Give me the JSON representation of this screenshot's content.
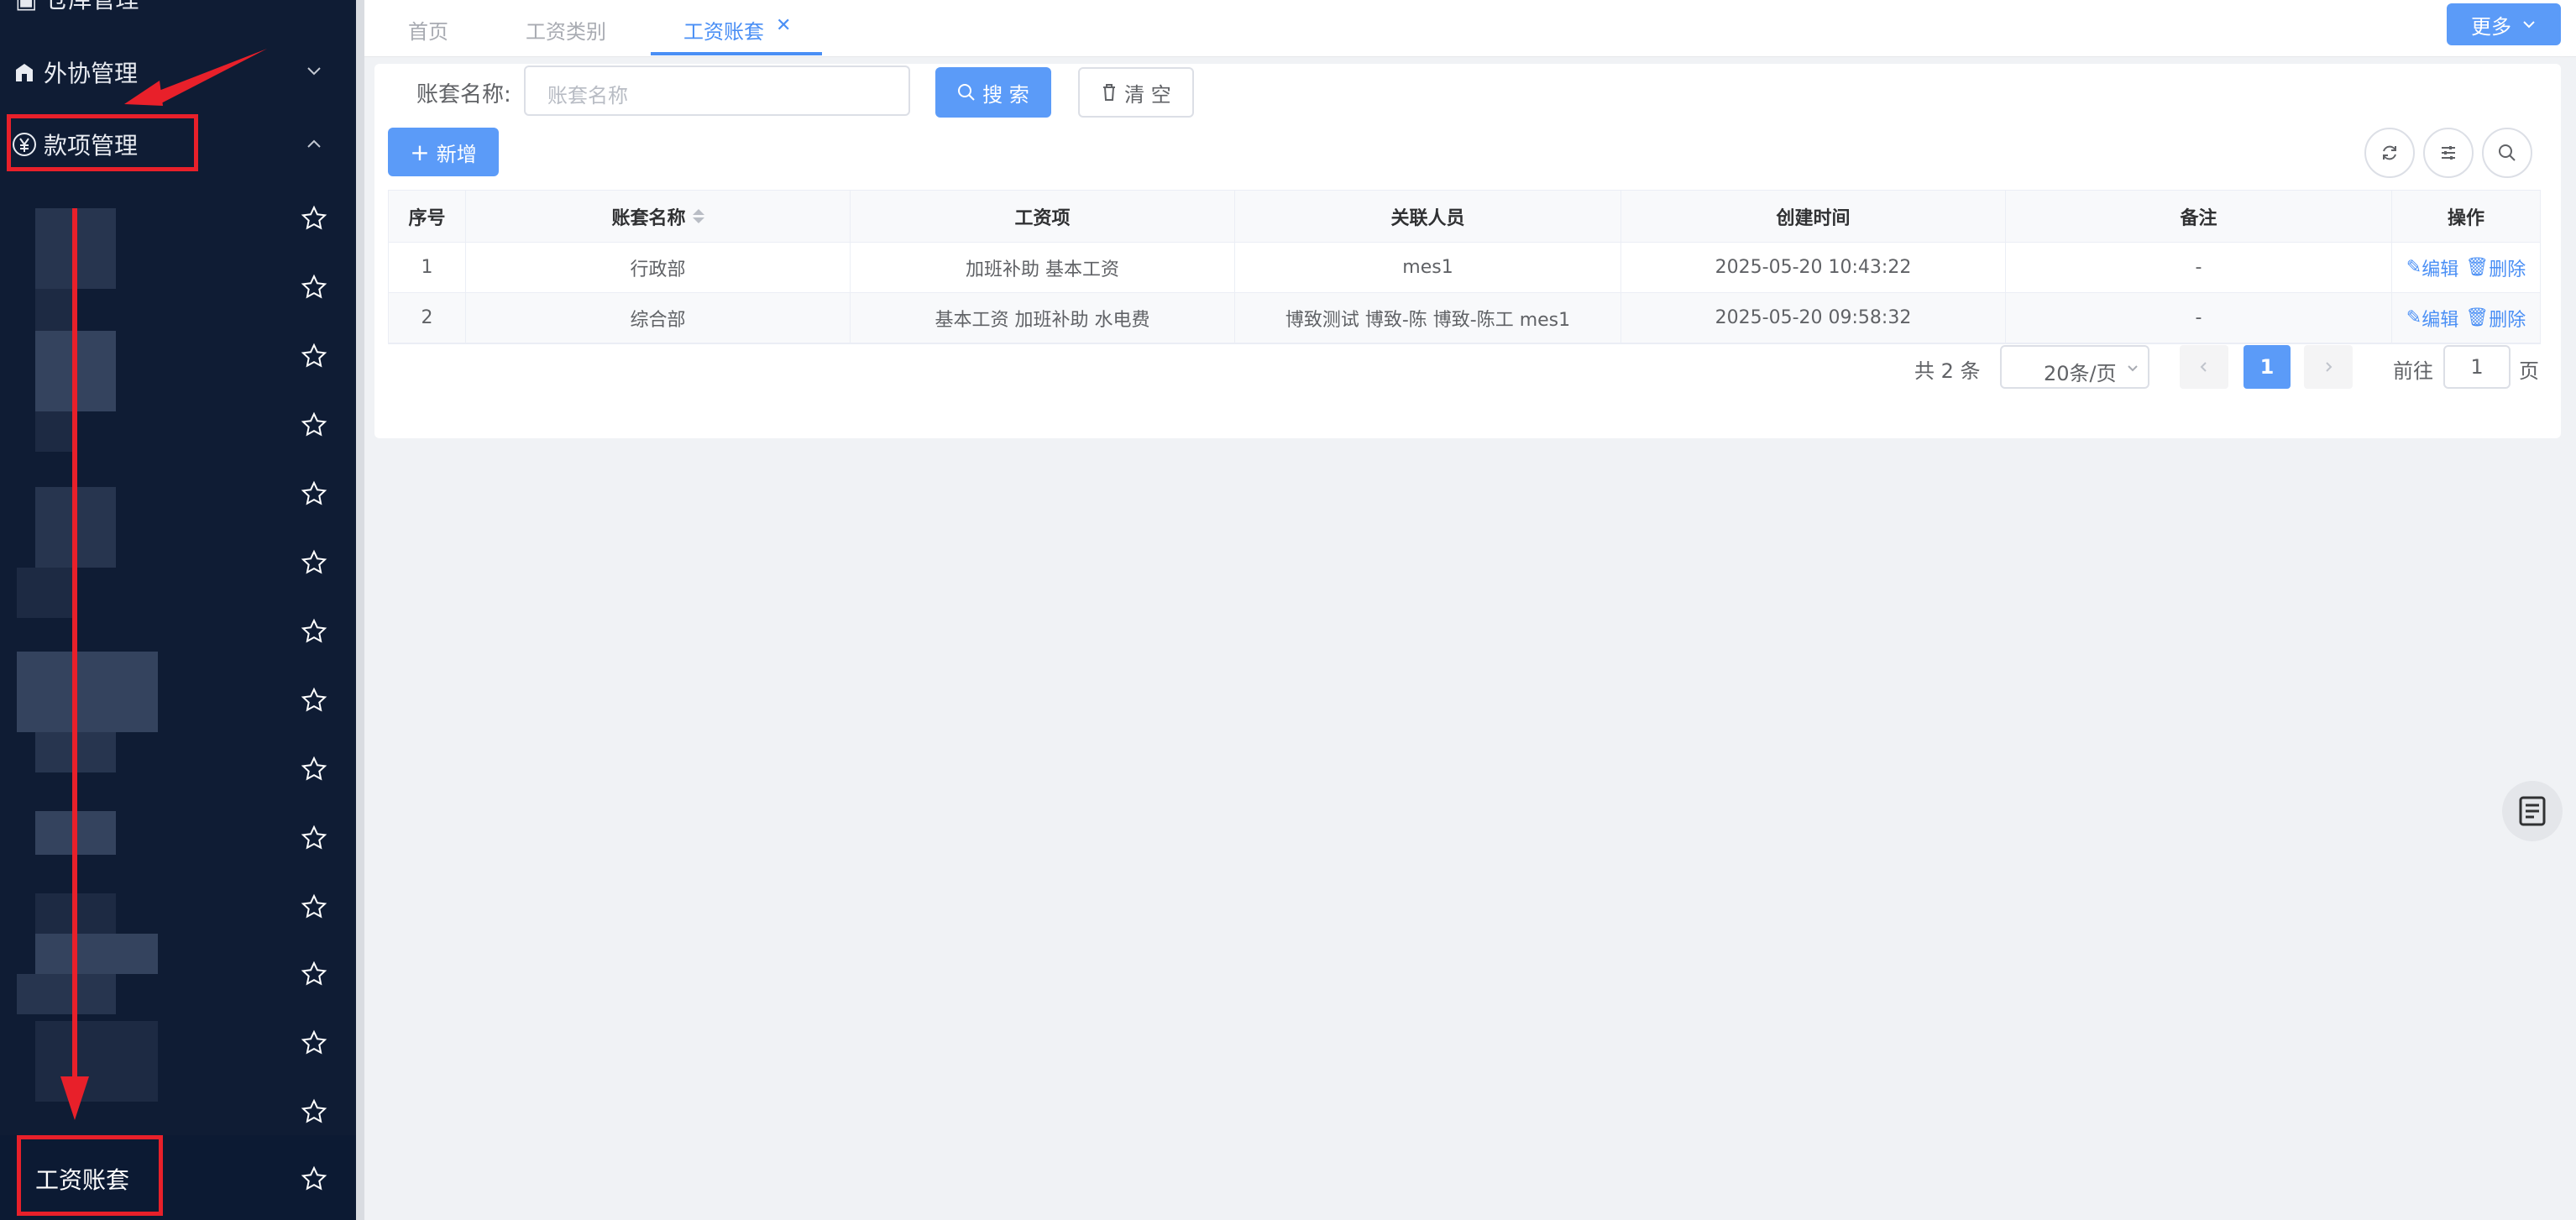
{
  "sidebar": {
    "top_partial_label": "仓库管理",
    "outsourcing_label": "外协管理",
    "payment_label": "款项管理",
    "selected_label": "工资账套",
    "star_count": 15
  },
  "tabs": [
    {
      "label": "首页"
    },
    {
      "label": "工资类别"
    },
    {
      "label": "工资账套"
    }
  ],
  "more_label": "更多",
  "search": {
    "label": "账套名称:",
    "placeholder": "账套名称",
    "search_label": "搜 索",
    "clear_label": "清 空"
  },
  "add_label": "新增",
  "table": {
    "headers": [
      "序号",
      "账套名称",
      "工资项",
      "关联人员",
      "创建时间",
      "备注",
      "操作"
    ],
    "rows": [
      {
        "idx": "1",
        "name": "行政部",
        "items": "加班补助 基本工资",
        "people": "mes1",
        "created": "2025-05-20 10:43:22",
        "remark": "-"
      },
      {
        "idx": "2",
        "name": "综合部",
        "items": "基本工资 加班补助 水电费",
        "people": "博致测试 博致-陈 博致-陈工 mes1",
        "created": "2025-05-20 09:58:32",
        "remark": "-"
      }
    ],
    "edit_label": "编辑",
    "delete_label": "删除"
  },
  "pagination": {
    "total_text": "共 2 条",
    "page_size": "20条/页",
    "current_page": "1",
    "goto_label": "前往",
    "goto_value": "1",
    "page_suffix": "页"
  },
  "colors": {
    "sidebar_bg": "#0f1c34",
    "primary": "#5b9bf8",
    "annotation_red": "#e8202a"
  }
}
